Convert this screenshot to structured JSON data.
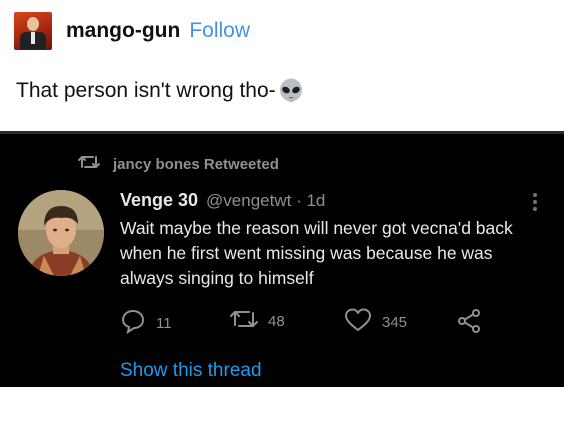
{
  "post": {
    "username": "mango-gun",
    "follow_label": "Follow",
    "caption": "That person isn't wrong tho-",
    "caption_emoji": "alien-face-icon"
  },
  "tweet": {
    "retweet_label": "jancy bones Retweeted",
    "author_name": "Venge 30",
    "handle_time": "@vengetwt · 1d",
    "body": "Wait maybe the reason will never got vecna'd back when he first went missing was because he was always singing to himself",
    "actions": {
      "replies": "11",
      "retweets": "48",
      "likes": "345"
    },
    "show_thread_label": "Show this thread"
  },
  "colors": {
    "tweet_background": "#000000",
    "link_blue": "#1d9bf0",
    "follow_blue": "#4a90e2",
    "muted_text": "#8b9196"
  }
}
